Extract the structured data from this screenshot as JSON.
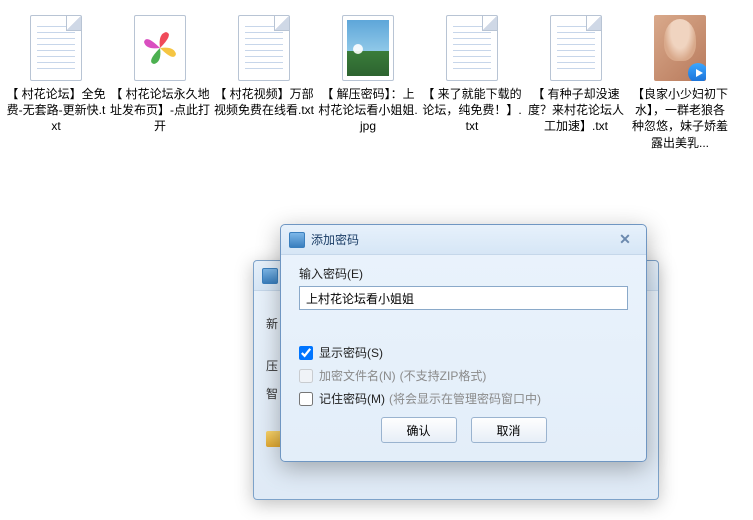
{
  "files": [
    {
      "type": "txt",
      "label": "【 村花论坛】全免费-无套路-更新快.txt"
    },
    {
      "type": "pinwheel",
      "label": "【 村花论坛永久地址发布页】-点此打开"
    },
    {
      "type": "txt",
      "label": "【 村花视频】万部视频免费在线看.txt"
    },
    {
      "type": "jpg",
      "label": "【 解压密码】：上村花论坛看小姐姐.jpg"
    },
    {
      "type": "txt",
      "label": "【 来了就能下载的论坛，纯免费！】.txt"
    },
    {
      "type": "txt",
      "label": "【 有种子却没速度？来村花论坛人工加速】.txt"
    },
    {
      "type": "video",
      "label": "【良家小少妇初下水】，一群老狼各种忽悠，妹子娇羞露出美乳..."
    }
  ],
  "back_dialog": {
    "row_new": "新",
    "row_compress": "压",
    "row_smart": "智"
  },
  "dialog": {
    "title": "添加密码",
    "input_label": "输入密码(E)",
    "input_value": "上村花论坛看小姐姐",
    "show_pwd": "显示密码(S)",
    "encrypt_names": "加密文件名(N)",
    "encrypt_hint": "(不支持ZIP格式)",
    "remember_pwd": "记住密码(M)",
    "remember_hint": "(将会显示在管理密码窗口中)",
    "ok": "确认",
    "cancel": "取消"
  }
}
